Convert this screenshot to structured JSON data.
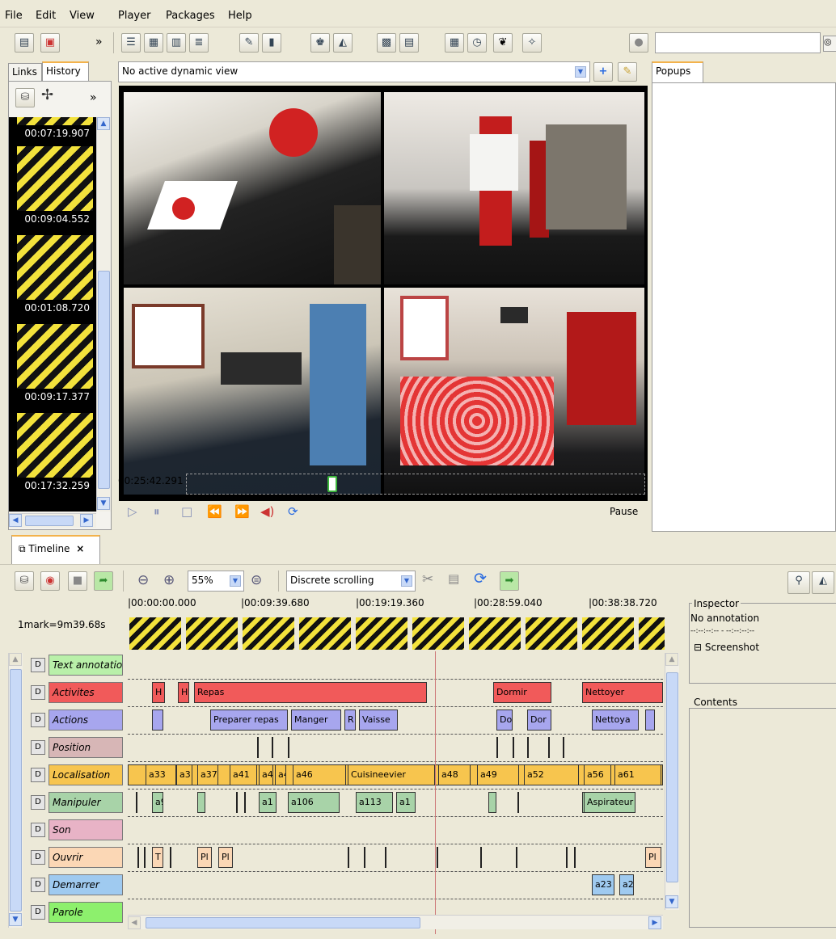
{
  "menu": [
    "File",
    "Edit",
    "View",
    "Player",
    "Packages",
    "Help"
  ],
  "left_tabs": [
    "Links",
    "History"
  ],
  "history": {
    "times": [
      "00:07:19.907",
      "00:09:04.552",
      "00:01:08.720",
      "00:09:17.377",
      "00:17:32.259"
    ]
  },
  "view_selector": "No active dynamic view",
  "popups_tab": "Popups",
  "player": {
    "time": "00:25:42.291",
    "status": "Pause",
    "progress_fraction": 0.4
  },
  "timeline": {
    "tab_label": "Timeline",
    "close_glyph": "×",
    "zoom": "55%",
    "scroll_mode": "Discrete scrolling",
    "scale": "1mark=9m39.68s",
    "ruler": [
      "|00:00:00.000",
      "|00:09:39.680",
      "|00:19:19.360",
      "|00:28:59.040",
      "|00:38:38.720"
    ],
    "rows": [
      {
        "label": "Text annotatio",
        "color": "#b9f0a9",
        "anns": []
      },
      {
        "label": "Activites",
        "color": "#f15a5a",
        "anns": [
          {
            "t": "H",
            "c": "#f15a5a"
          },
          {
            "t": "H",
            "c": "#f15a5a"
          },
          {
            "t": "Repas",
            "c": "#f15a5a"
          },
          {
            "t": "Dormir",
            "c": "#f15a5a"
          },
          {
            "t": "Nettoyer",
            "c": "#f15a5a"
          }
        ]
      },
      {
        "label": "Actions",
        "color": "#a7a6ee",
        "anns": [
          {
            "t": "",
            "c": "#a7a6ee"
          },
          {
            "t": "Preparer repas",
            "c": "#a7a6ee"
          },
          {
            "t": "Manger",
            "c": "#a7a6ee"
          },
          {
            "t": "R",
            "c": "#a7a6ee"
          },
          {
            "t": "Vaisse",
            "c": "#a7a6ee"
          },
          {
            "t": "Do",
            "c": "#a7a6ee"
          },
          {
            "t": "Dor",
            "c": "#a7a6ee"
          },
          {
            "t": "Nettoya",
            "c": "#a7a6ee"
          },
          {
            "t": "",
            "c": "#a7a6ee"
          }
        ]
      },
      {
        "label": "Position",
        "color": "#d7b6b6",
        "anns": []
      },
      {
        "label": "Localisation",
        "color": "#f7c54e",
        "anns": [
          {
            "t": "a33"
          },
          {
            "t": "a3"
          },
          {
            "t": "a37"
          },
          {
            "t": "a41"
          },
          {
            "t": "a4"
          },
          {
            "t": "a4"
          },
          {
            "t": "a46"
          },
          {
            "t": "Cuisineevier"
          },
          {
            "t": "a48"
          },
          {
            "t": "a49"
          },
          {
            "t": "a52"
          },
          {
            "t": "a56"
          },
          {
            "t": "a61"
          }
        ]
      },
      {
        "label": "Manipuler",
        "color": "#a8d3a8",
        "anns": [
          {
            "t": "a9"
          },
          {
            "t": ""
          },
          {
            "t": "a1"
          },
          {
            "t": "a106"
          },
          {
            "t": "a113"
          },
          {
            "t": "a1"
          },
          {
            "t": ""
          },
          {
            "t": ""
          },
          {
            "t": "Aspirateur"
          }
        ]
      },
      {
        "label": "Son",
        "color": "#e8b3c6",
        "anns": []
      },
      {
        "label": "Ouvrir",
        "color": "#fbd7b5",
        "anns": [
          {
            "t": "T"
          },
          {
            "t": "Pl"
          },
          {
            "t": "Pl"
          },
          {
            "t": "Pl"
          }
        ]
      },
      {
        "label": "Demarrer",
        "color": "#9fcaf0",
        "anns": [
          {
            "t": "a23"
          },
          {
            "t": "a2"
          }
        ]
      },
      {
        "label": "Parole",
        "color": "#8df06d",
        "anns": []
      }
    ]
  },
  "inspector": {
    "title": "Inspector",
    "status": "No annotation",
    "dashes": "--:--:--:-- - --:--:--:--",
    "screenshot": "Screenshot",
    "contents": "Contents"
  },
  "colors": {
    "accent": "#f7c54e",
    "cursor": "#c77"
  }
}
